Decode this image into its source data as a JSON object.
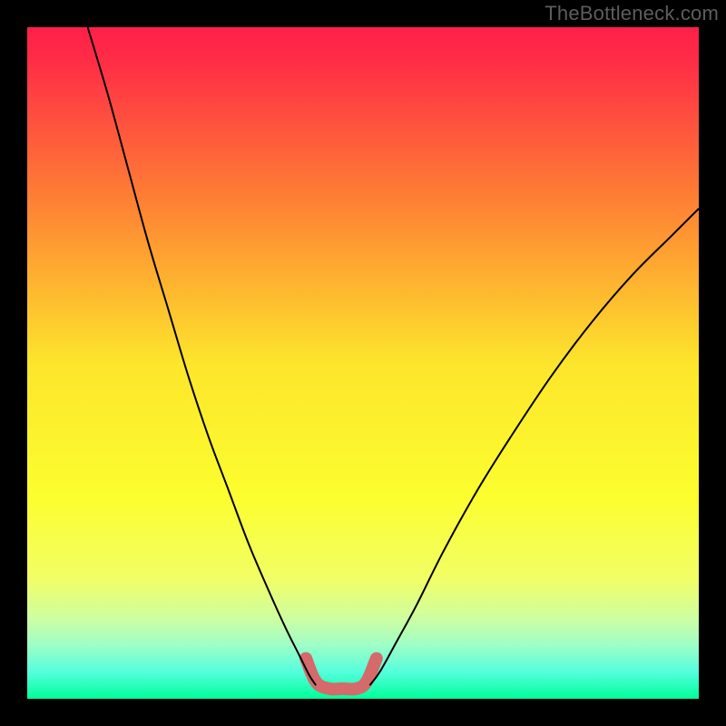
{
  "watermark": "TheBottleneck.com",
  "chart_data": {
    "type": "line",
    "title": "",
    "xlabel": "",
    "ylabel": "",
    "xlim": [
      0,
      100
    ],
    "ylim": [
      0,
      100
    ],
    "grid": false,
    "legend": false,
    "background_gradient": {
      "stops": [
        {
          "offset": 0.0,
          "color": "#ff1f4a"
        },
        {
          "offset": 0.05,
          "color": "#ff2d46"
        },
        {
          "offset": 0.25,
          "color": "#fe7d34"
        },
        {
          "offset": 0.5,
          "color": "#fde52c"
        },
        {
          "offset": 0.7,
          "color": "#fcfe2e"
        },
        {
          "offset": 0.82,
          "color": "#f2fe65"
        },
        {
          "offset": 0.88,
          "color": "#cefea1"
        },
        {
          "offset": 0.92,
          "color": "#9ffec6"
        },
        {
          "offset": 0.96,
          "color": "#55fedd"
        },
        {
          "offset": 1.0,
          "color": "#00ff99"
        }
      ]
    },
    "series": [
      {
        "name": "left-curve",
        "stroke": "#000000",
        "data": [
          {
            "x": 9.0,
            "y": 100.0
          },
          {
            "x": 12.0,
            "y": 90.0
          },
          {
            "x": 15.0,
            "y": 79.0
          },
          {
            "x": 18.0,
            "y": 68.0
          },
          {
            "x": 21.0,
            "y": 58.0
          },
          {
            "x": 24.0,
            "y": 48.0
          },
          {
            "x": 27.0,
            "y": 39.0
          },
          {
            "x": 30.0,
            "y": 31.0
          },
          {
            "x": 33.0,
            "y": 23.0
          },
          {
            "x": 36.0,
            "y": 16.0
          },
          {
            "x": 38.5,
            "y": 10.5
          },
          {
            "x": 40.5,
            "y": 6.5
          },
          {
            "x": 42.0,
            "y": 3.5
          },
          {
            "x": 43.0,
            "y": 2.0
          }
        ]
      },
      {
        "name": "right-curve",
        "stroke": "#000000",
        "data": [
          {
            "x": 51.0,
            "y": 2.0
          },
          {
            "x": 52.5,
            "y": 4.0
          },
          {
            "x": 55.0,
            "y": 8.5
          },
          {
            "x": 58.0,
            "y": 14.0
          },
          {
            "x": 62.0,
            "y": 22.0
          },
          {
            "x": 67.0,
            "y": 31.0
          },
          {
            "x": 72.0,
            "y": 39.0
          },
          {
            "x": 78.0,
            "y": 48.0
          },
          {
            "x": 84.0,
            "y": 56.0
          },
          {
            "x": 90.0,
            "y": 63.0
          },
          {
            "x": 96.0,
            "y": 69.0
          },
          {
            "x": 100.0,
            "y": 73.0
          }
        ]
      },
      {
        "name": "valley-highlight",
        "stroke": "#d46a6a",
        "stroke_width": 14,
        "data": [
          {
            "x": 41.5,
            "y": 6.0
          },
          {
            "x": 43.0,
            "y": 2.5
          },
          {
            "x": 45.0,
            "y": 1.5
          },
          {
            "x": 47.0,
            "y": 1.5
          },
          {
            "x": 49.0,
            "y": 1.5
          },
          {
            "x": 50.5,
            "y": 2.5
          },
          {
            "x": 52.0,
            "y": 6.0
          }
        ]
      }
    ]
  }
}
